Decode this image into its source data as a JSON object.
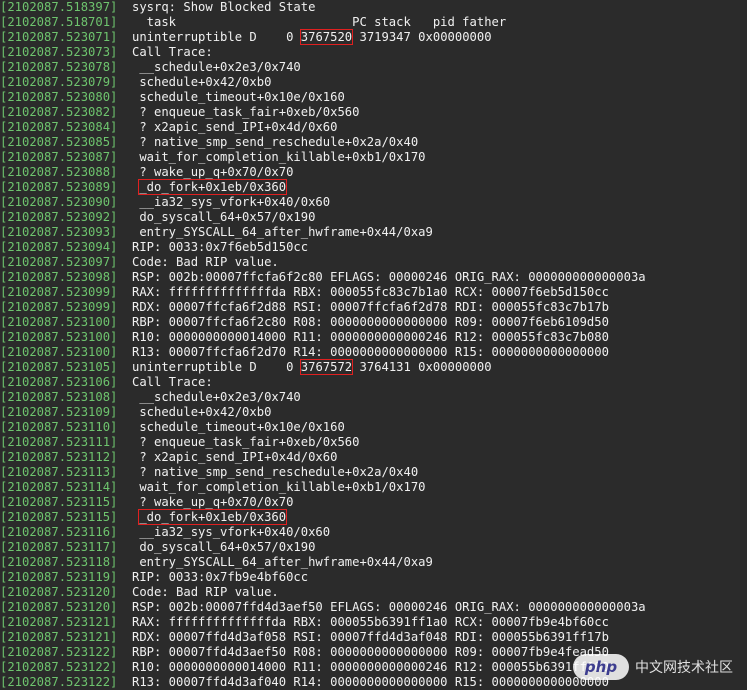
{
  "terminal": {
    "lines": [
      {
        "ts": "[2102087.518397]",
        "text": "sysrq: Show Blocked State",
        "green": false,
        "hl": null
      },
      {
        "ts": "[2102087.518701]",
        "text": "  task                        PC stack   pid father",
        "green": false,
        "hl": null
      },
      {
        "ts": "[2102087.523071]",
        "text": "uninterruptible D    0 ",
        "text2": "3767520",
        "text3": " 3719347 0x00000000",
        "green": false,
        "hl": "pid"
      },
      {
        "ts": "[2102087.523073]",
        "text": "Call Trace:",
        "green": false,
        "hl": null
      },
      {
        "ts": "[2102087.523078]",
        "text": " __schedule+0x2e3/0x740",
        "green": false,
        "hl": null
      },
      {
        "ts": "[2102087.523079]",
        "text": " schedule+0x42/0xb0",
        "green": false,
        "hl": null
      },
      {
        "ts": "[2102087.523080]",
        "text": " schedule_timeout+0x10e/0x160",
        "green": false,
        "hl": null
      },
      {
        "ts": "[2102087.523082]",
        "text": " ? enqueue_task_fair+0xeb/0x560",
        "green": false,
        "hl": null
      },
      {
        "ts": "[2102087.523084]",
        "text": " ? x2apic_send_IPI+0x4d/0x60",
        "green": false,
        "hl": null
      },
      {
        "ts": "[2102087.523085]",
        "text": " ? native_smp_send_reschedule+0x2a/0x40",
        "green": false,
        "hl": null
      },
      {
        "ts": "[2102087.523087]",
        "text": " wait_for_completion_killable+0xb1/0x170",
        "green": false,
        "hl": null
      },
      {
        "ts": "[2102087.523088]",
        "text": " ? wake_up_q+0x70/0x70",
        "green": false,
        "hl": null
      },
      {
        "ts": "[2102087.523089]",
        "text": " ",
        "text2": "_do_fork+0x1eb/0x360",
        "text3": "",
        "green": false,
        "hl": "fork"
      },
      {
        "ts": "[2102087.523090]",
        "text": " __ia32_sys_vfork+0x40/0x60",
        "green": false,
        "hl": null
      },
      {
        "ts": "[2102087.523092]",
        "text": " do_syscall_64+0x57/0x190",
        "green": false,
        "hl": null
      },
      {
        "ts": "[2102087.523093]",
        "text": " entry_SYSCALL_64_after_hwframe+0x44/0xa9",
        "green": false,
        "hl": null
      },
      {
        "ts": "[2102087.523094]",
        "text": "RIP: 0033:0x7f6eb5d150cc",
        "green": false,
        "hl": null
      },
      {
        "ts": "[2102087.523097]",
        "text": "Code: Bad RIP value.",
        "green": false,
        "hl": null
      },
      {
        "ts": "[2102087.523098]",
        "text": "RSP: 002b:00007ffcfa6f2c80 EFLAGS: 00000246 ORIG_RAX: 000000000000003a",
        "green": false,
        "hl": null
      },
      {
        "ts": "[2102087.523099]",
        "text": "RAX: ffffffffffffffda RBX: 000055fc83c7b1a0 RCX: 00007f6eb5d150cc",
        "green": false,
        "hl": null
      },
      {
        "ts": "[2102087.523099]",
        "text": "RDX: 00007ffcfa6f2d88 RSI: 00007ffcfa6f2d78 RDI: 000055fc83c7b17b",
        "green": false,
        "hl": null
      },
      {
        "ts": "[2102087.523100]",
        "text": "RBP: 00007ffcfa6f2c80 R08: 0000000000000000 R09: 00007f6eb6109d50",
        "green": false,
        "hl": null
      },
      {
        "ts": "[2102087.523100]",
        "text": "R10: 0000000000014000 R11: 0000000000000246 R12: 000055fc83c7b080",
        "green": false,
        "hl": null
      },
      {
        "ts": "[2102087.523100]",
        "text": "R13: 00007ffcfa6f2d70 R14: 0000000000000000 R15: 0000000000000000",
        "green": false,
        "hl": null
      },
      {
        "ts": "[2102087.523105]",
        "text": "uninterruptible D    0 ",
        "text2": "3767572",
        "text3": " 3764131 0x00000000",
        "green": false,
        "hl": "pid"
      },
      {
        "ts": "[2102087.523106]",
        "text": "Call Trace:",
        "green": false,
        "hl": null
      },
      {
        "ts": "[2102087.523108]",
        "text": " __schedule+0x2e3/0x740",
        "green": false,
        "hl": null
      },
      {
        "ts": "[2102087.523109]",
        "text": " schedule+0x42/0xb0",
        "green": false,
        "hl": null
      },
      {
        "ts": "[2102087.523110]",
        "text": " schedule_timeout+0x10e/0x160",
        "green": false,
        "hl": null
      },
      {
        "ts": "[2102087.523111]",
        "text": " ? enqueue_task_fair+0xeb/0x560",
        "green": false,
        "hl": null
      },
      {
        "ts": "[2102087.523112]",
        "text": " ? x2apic_send_IPI+0x4d/0x60",
        "green": false,
        "hl": null
      },
      {
        "ts": "[2102087.523113]",
        "text": " ? native_smp_send_reschedule+0x2a/0x40",
        "green": false,
        "hl": null
      },
      {
        "ts": "[2102087.523114]",
        "text": " wait_for_completion_killable+0xb1/0x170",
        "green": false,
        "hl": null
      },
      {
        "ts": "[2102087.523115]",
        "text": " ? wake_up_q+0x70/0x70",
        "green": false,
        "hl": null
      },
      {
        "ts": "[2102087.523115]",
        "text": " ",
        "text2": "_do_fork+0x1eb/0x360",
        "text3": "",
        "green": false,
        "hl": "fork"
      },
      {
        "ts": "[2102087.523116]",
        "text": " __ia32_sys_vfork+0x40/0x60",
        "green": false,
        "hl": null
      },
      {
        "ts": "[2102087.523117]",
        "text": " do_syscall_64+0x57/0x190",
        "green": false,
        "hl": null
      },
      {
        "ts": "[2102087.523118]",
        "text": " entry_SYSCALL_64_after_hwframe+0x44/0xa9",
        "green": false,
        "hl": null
      },
      {
        "ts": "[2102087.523119]",
        "text": "RIP: 0033:0x7fb9e4bf60cc",
        "green": false,
        "hl": null
      },
      {
        "ts": "[2102087.523120]",
        "text": "Code: Bad RIP value.",
        "green": false,
        "hl": null
      },
      {
        "ts": "[2102087.523120]",
        "text": "RSP: 002b:00007ffd4d3aef50 EFLAGS: 00000246 ORIG_RAX: 000000000000003a",
        "green": false,
        "hl": null
      },
      {
        "ts": "[2102087.523121]",
        "text": "RAX: ffffffffffffffda RBX: 000055b6391ff1a0 RCX: 00007fb9e4bf60cc",
        "green": false,
        "hl": null
      },
      {
        "ts": "[2102087.523121]",
        "text": "RDX: 00007ffd4d3af058 RSI: 00007ffd4d3af048 RDI: 000055b6391ff17b",
        "green": false,
        "hl": null
      },
      {
        "ts": "[2102087.523122]",
        "text": "RBP: 00007ffd4d3aef50 R08: 0000000000000000 R09: 00007fb9e4fead50",
        "green": false,
        "hl": null
      },
      {
        "ts": "[2102087.523122]",
        "text": "R10: 0000000000014000 R11: 0000000000000246 R12: 000055b6391ff080",
        "green": false,
        "hl": null
      },
      {
        "ts": "[2102087.523122]",
        "text": "R13: 00007ffd4d3af040 R14: 0000000000000000 R15: 0000000000000000",
        "green": false,
        "hl": null
      }
    ]
  },
  "watermark": {
    "logo": "php",
    "text": "中文网技术社区"
  },
  "colors": {
    "background": "#2b2b2b",
    "timestamp": "#6ec46e",
    "text": "#f0f0f0",
    "highlight_box": "#e02020"
  }
}
